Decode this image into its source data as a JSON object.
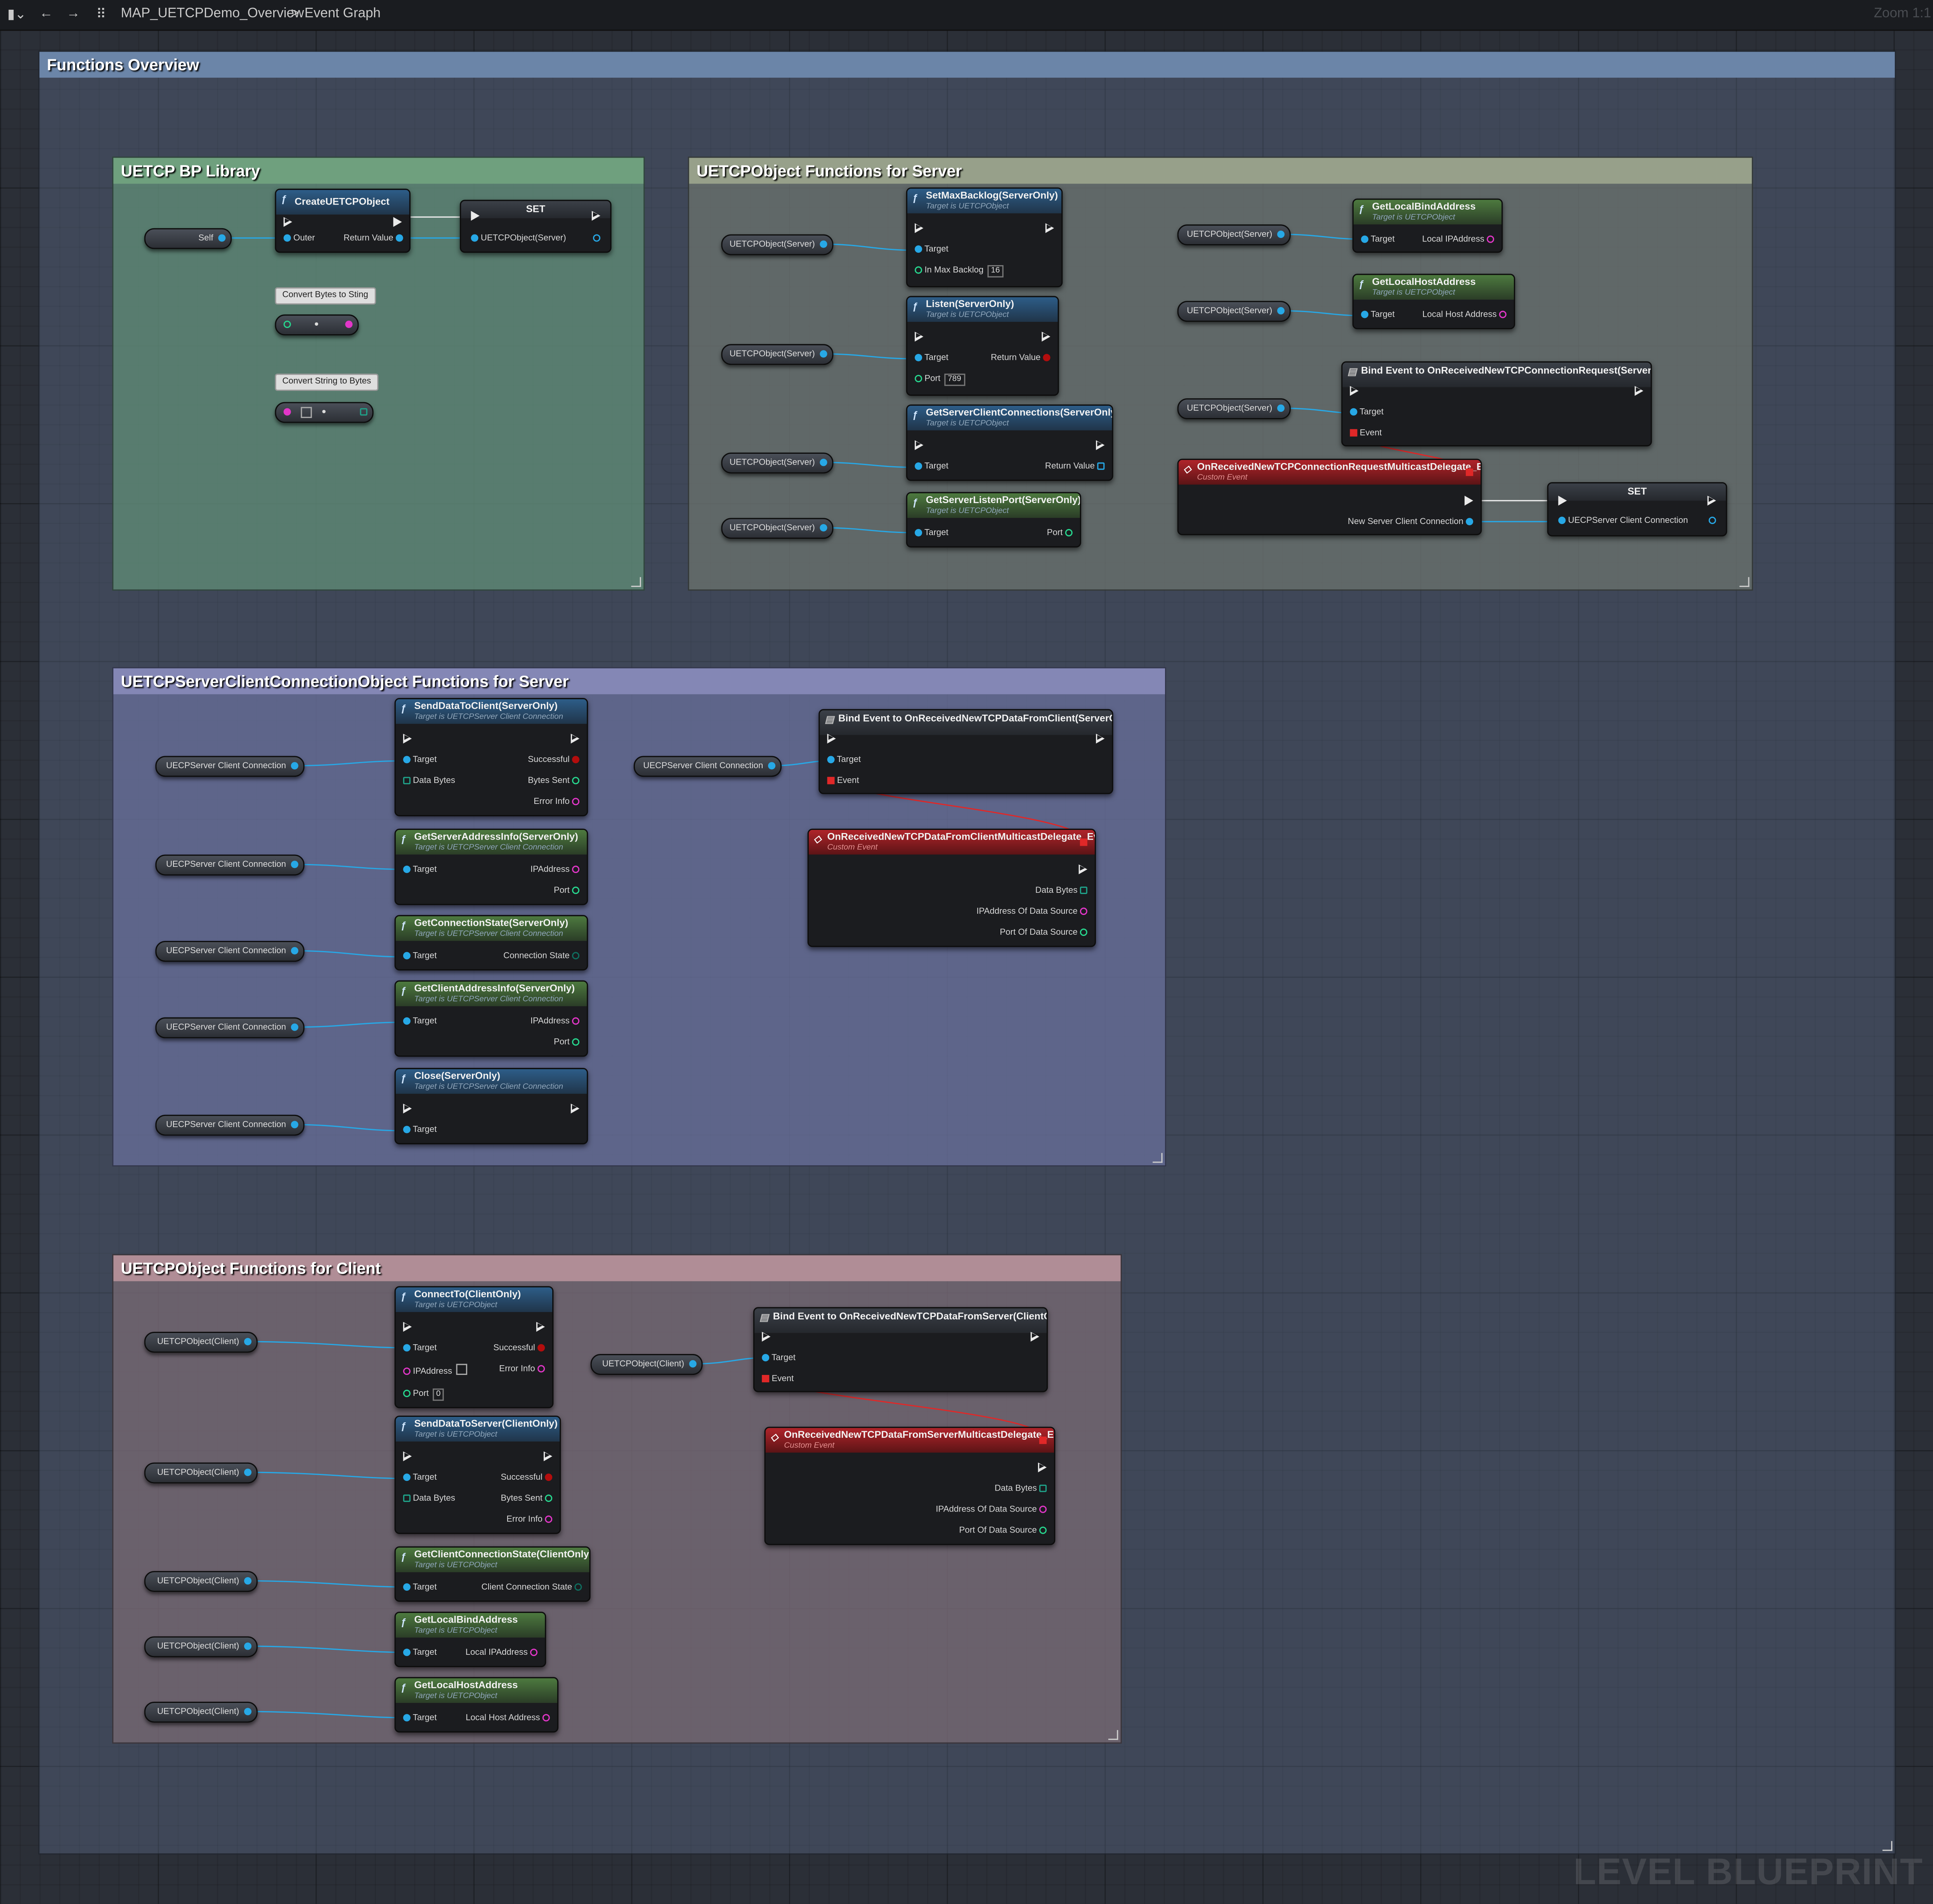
{
  "toolbar": {
    "breadcrumb_map": "MAP_UETCPDemo_Overview",
    "breadcrumb_sep": ">",
    "breadcrumb_graph": "Event Graph",
    "zoom_label": "Zoom 1:1"
  },
  "watermark": "LEVEL BLUEPRINT",
  "comments": {
    "overview": "Functions Overview",
    "bp_library": "UETCP BP Library",
    "server_functions": "UETCPObject Functions for Server",
    "client_connection_functions": "UETCPServerClientConnectionObject Functions for Server",
    "client_functions": "UETCPObject Functions for Client"
  },
  "library": {
    "self_var": "Self",
    "create_node": {
      "title": "CreateUETCPObject",
      "outer": "Outer",
      "return": "Return Value"
    },
    "set_node": {
      "title": "SET",
      "pin": "UETCPObject(Server)"
    },
    "convert_bytes_to_string": "Convert Bytes to Sting",
    "convert_string_to_bytes": "Convert String to Bytes"
  },
  "server": {
    "var_label": "UETCPObject(Server)",
    "target_sub": "Target is UETCPObject",
    "set_max_backlog": {
      "title": "SetMaxBacklog(ServerOnly)",
      "target": "Target",
      "in": "In Max Backlog",
      "value": "16"
    },
    "listen": {
      "title": "Listen(ServerOnly)",
      "target": "Target",
      "ret": "Return Value",
      "port": "Port",
      "port_value": "789"
    },
    "get_server_client_connections": {
      "title": "GetServerClientConnections(ServerOnly)",
      "target": "Target",
      "ret": "Return Value"
    },
    "get_server_listen_port": {
      "title": "GetServerListenPort(ServerOnly)",
      "target": "Target",
      "port": "Port"
    },
    "get_local_bind_address": {
      "title": "GetLocalBindAddress",
      "target": "Target",
      "out": "Local IPAddress"
    },
    "get_local_host_address": {
      "title": "GetLocalHostAddress",
      "target": "Target",
      "out": "Local Host Address"
    },
    "bind_event": {
      "title": "Bind Event to OnReceivedNewTCPConnectionRequest(ServerOnly)",
      "target": "Target",
      "event": "Event"
    },
    "custom_event": {
      "title": "OnReceivedNewTCPConnectionRequestMulticastDelegate_Event",
      "sub": "Custom Event",
      "out": "New Server Client Connection"
    },
    "set_conn": {
      "title": "SET",
      "pin": "UECPServer Client Connection"
    }
  },
  "connection": {
    "var_label": "UECPServer Client Connection",
    "target_sub": "Target is UETCPServer Client Connection",
    "send_data_to_client": {
      "title": "SendDataToClient(ServerOnly)",
      "target": "Target",
      "data": "Data Bytes",
      "successful": "Successful",
      "sent": "Bytes Sent",
      "error": "Error Info"
    },
    "get_server_address_info": {
      "title": "GetServerAddressInfo(ServerOnly)",
      "target": "Target",
      "ip": "IPAddress",
      "port": "Port"
    },
    "get_connection_state": {
      "title": "GetConnectionState(ServerOnly)",
      "target": "Target",
      "state": "Connection State"
    },
    "get_client_address_info": {
      "title": "GetClientAddressInfo(ServerOnly)",
      "target": "Target",
      "ip": "IPAddress",
      "port": "Port"
    },
    "close": {
      "title": "Close(ServerOnly)",
      "target": "Target"
    },
    "bind_event": {
      "title": "Bind Event to OnReceivedNewTCPDataFromClient(ServerOnly)",
      "target": "Target",
      "event": "Event"
    },
    "custom_event": {
      "title": "OnReceivedNewTCPDataFromClientMulticastDelegate_Event",
      "sub": "Custom Event",
      "data": "Data Bytes",
      "ip": "IPAddress Of Data Source",
      "port": "Port Of Data Source"
    }
  },
  "client": {
    "var_label": "UETCPObject(Client)",
    "target_sub": "Target is UETCPObject",
    "connect_to": {
      "title": "ConnectTo(ClientOnly)",
      "target": "Target",
      "ip": "IPAddress",
      "port": "Port",
      "port_value": "0",
      "successful": "Successful",
      "error": "Error Info"
    },
    "send_data_to_server": {
      "title": "SendDataToServer(ClientOnly)",
      "target": "Target",
      "data": "Data Bytes",
      "successful": "Successful",
      "sent": "Bytes Sent",
      "error": "Error Info"
    },
    "get_client_connection_state": {
      "title": "GetClientConnectionState(ClientOnly)",
      "target": "Target",
      "state": "Client Connection State"
    },
    "get_local_bind_address": {
      "title": "GetLocalBindAddress",
      "target": "Target",
      "out": "Local IPAddress"
    },
    "get_local_host_address": {
      "title": "GetLocalHostAddress",
      "target": "Target",
      "out": "Local Host Address"
    },
    "bind_event": {
      "title": "Bind Event to OnReceivedNewTCPDataFromServer(ClientOnly)",
      "target": "Target",
      "event": "Event"
    },
    "custom_event": {
      "title": "OnReceivedNewTCPDataFromServerMulticastDelegate_Event",
      "sub": "Custom Event",
      "data": "Data Bytes",
      "ip": "IPAddress Of Data Source",
      "port": "Port Of Data Source"
    }
  },
  "colors": {
    "overview_header": "#6b85a8",
    "library_fill": "#5f8275",
    "server_fill": "#676c6a",
    "connection_fill": "#636a8c",
    "client_fill": "#74686f",
    "exec_pin": "#eaeaea",
    "object_pin": "#27a8e6",
    "string_pin": "#e236c8",
    "int_pin": "#27d68e",
    "bool_pin": "#b30d0d"
  }
}
